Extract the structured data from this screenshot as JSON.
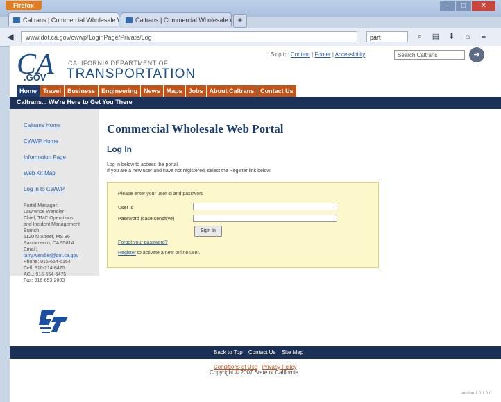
{
  "browser": {
    "app_button": "Firefox",
    "tabs": [
      {
        "label": "Caltrans | Commercial Wholesale We..."
      },
      {
        "label": "Caltrans | Commercial Wholesale We..."
      }
    ],
    "new_tab": "+",
    "url": "www.dot.ca.gov/cwwp/LoginPage/Private/Log",
    "search_value": "part"
  },
  "header": {
    "logo_ca": "CA",
    "logo_gov": ".GOV",
    "department": "CALIFORNIA DEPARTMENT OF",
    "transportation": "TRANSPORTATION",
    "utility_prefix": "Skip to:",
    "utility_links": [
      "Content",
      "Footer",
      "Accessibility"
    ],
    "search_placeholder": "Search Caltrans"
  },
  "menu": [
    "Home",
    "Travel",
    "Business",
    "Engineering",
    "News",
    "Maps",
    "Jobs",
    "About Caltrans",
    "Contact Us"
  ],
  "tagline": "Caltrans... We're Here to Get You There",
  "sidebar": {
    "links": [
      "Caltrans Home",
      "CWWP Home",
      "Information Page",
      "Web Kit Map",
      "Log in to CWWP"
    ],
    "contact_title": "Portal Manager:",
    "contact_lines": [
      "Lawrence Wendler",
      "Chief, TMC Operations",
      "and Incident Management",
      "Branch",
      "1120 N Street, MS 36",
      "Sacramento, CA 95814",
      "Email:"
    ],
    "contact_email": "larry.wendler@dot.ca.gov",
    "contact_phones": [
      "Phone: 916-654-6164",
      "Cell: 916-214-8475",
      "ACL: 916-654-6475",
      "Fax: 916-653-2003"
    ]
  },
  "main": {
    "portal_title": "Commercial Wholesale Web Portal",
    "login_heading": "Log In",
    "instructions_1": "Log in below to access the portal.",
    "instructions_2": "If you are a new user and have not registered, select the Register link below.",
    "prompt": "Please enter your user id and password",
    "uid_label": "User Id",
    "pw_label": "Password (case sensitive)",
    "signin_button": "Sign In",
    "forgot_link": "Forgot your password?",
    "register_link": "Register",
    "register_text": " to activate a new online user."
  },
  "footer": {
    "links": [
      "Back to Top",
      "Contact Us",
      "Site Map"
    ],
    "conditions": "Conditions of Use",
    "privacy": "Privacy Policy",
    "copyright": "Copyright © 2007 State of California",
    "version": "version 1.0.1.0.0"
  }
}
